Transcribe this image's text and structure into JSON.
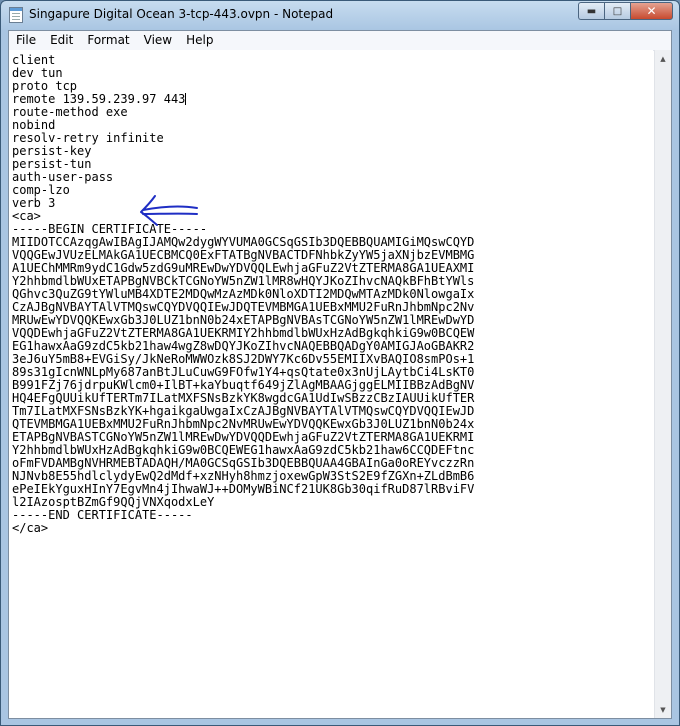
{
  "window": {
    "title": "Singapure Digital Ocean 3-tcp-443.ovpn - Notepad",
    "minimize_glyph": "▬",
    "maximize_glyph": "□",
    "close_glyph": "✕"
  },
  "menu": {
    "items": [
      {
        "label": "File"
      },
      {
        "label": "Edit"
      },
      {
        "label": "Format"
      },
      {
        "label": "View"
      },
      {
        "label": "Help"
      }
    ]
  },
  "editor": {
    "lines_before_caret": "client\ndev tun\nproto tcp\nremote 139.59.239.97 443",
    "lines_after_caret": "\nroute-method exe\nnobind\nresolv-retry infinite\npersist-key\npersist-tun\nauth-user-pass\ncomp-lzo\nverb 3\n<ca>\n-----BEGIN CERTIFICATE-----\nMIIDOTCCAzqgAwIBAgIJAMQw2dygWYVUMA0GCSqGSIb3DQEBBQUAMIGiMQswCQYD\nVQQGEwJVUzELMAkGA1UECBMCQ0ExFTATBgNVBACTDFNhbkZyYW5jaXNjbzEVMBMG\nA1UEChMMRm9ydC1Gdw5zdG9uMREwDwYDVQQLEwhjaGFuZ2VtZTERMA8GA1UEAXMI\nY2hhbmdlbWUxETAPBgNVBCkTCGNoYW5nZW1lMR8wHQYJKoZIhvcNAQkBFhBtYWls\nQGhvc3QuZG9tYWluMB4XDTE2MDQwMzAzMDk0NloXDTI2MDQwMTAzMDk0NlowgaIx\nCzAJBgNVBAYTAlVTMQswCQYDVQQIEwJDQTEVMBMGA1UEBxMMU2FuRnJhbmNpc2Nv\nMRUwEwYDVQQKEwxGb3J0LUZ1bnN0b24xETAPBgNVBAsTCGNoYW5nZW1lMREwDwYD\nVQQDEwhjaGFuZ2VtZTERMA8GA1UEKRMIY2hhbmdlbWUxHzAdBgkqhkiG9w0BCQEW\nEG1hawxAaG9zdC5kb21haw4wgZ8wDQYJKoZIhvcNAQEBBQADgY0AMIGJAoGBAKR2\n3eJ6uY5mB8+EVGiSy/JkNeRoMWWOzk8SJ2DWY7Kc6Dv55EMIIXvBAQIO8smPOs+1\n89s31gIcnWNLpMy687anBtJLuCuwG9FOfw1Y4+qsQtate0x3nUjLAytbCi4LsKT0\nB991FZj76jdrpuKWlcm0+IlBT+kaYbuqtf649jZlAgMBAAGjggELMIIBBzAdBgNV\nHQ4EFgQUUikUfTERTm7ILatMXFSNsBzkYK8wgdcGA1UdIwSBzzCBzIAUUikUfTER\nTm7ILatMXFSNsBzkYK+hgaikgaUwgaIxCzAJBgNVBAYTAlVTMQswCQYDVQQIEwJD\nQTEVMBMGA1UEBxMMU2FuRnJhbmNpc2NvMRUwEwYDVQQKEwxGb3J0LUZ1bnN0b24x\nETAPBgNVBASTCGNoYW5nZW1lMREwDwYDVQQDEwhjaGFuZ2VtZTERMA8GA1UEKRMI\nY2hhbmdlbWUxHzAdBgkqhkiG9w0BCQEWEG1hawxAaG9zdC5kb21haw6CCQDEFtnc\noFmFVDAMBgNVHRMEBTADAQH/MA0GCSqGSIb3DQEBBQUAA4GBAInGa0oREYvczzRn\nNJNvb8E55hdlclydyEwQ2dMdf+xzNHyh8hmzjoxewGpW3StS2E9fZGXn+ZLdBmB6\nePeIEkYguxHInY7EgvMn4jIhwaWJ++DOMyWBiNCf21UK8Gb30qifRuD87lRBviFV\nl2IAzosptBZmGf9QQjVNXqodxLeY\n-----END CERTIFICATE-----\n</ca>",
    "annotation_arrow_color": "#1f2ec4"
  }
}
